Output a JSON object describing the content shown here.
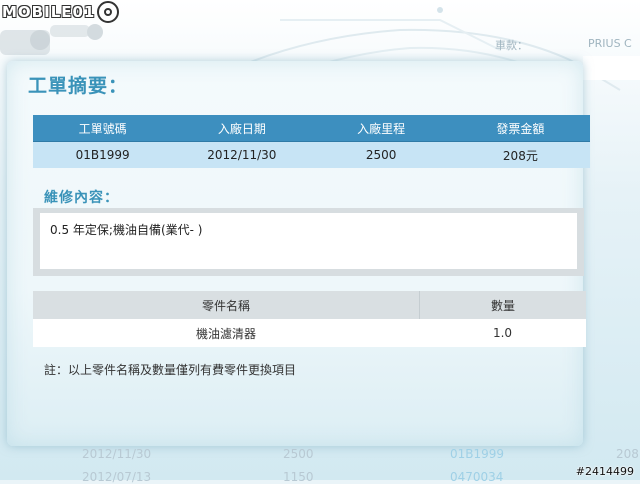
{
  "brand": {
    "logo_text": "MOBILE01"
  },
  "background": {
    "car_model_label": "車款：",
    "car_model_value": "PRIUS C",
    "bottom_rows": [
      [
        "2012/11/30",
        "2500",
        "01B1999",
        "208"
      ],
      [
        "2012/07/13",
        "1150",
        "0470034",
        ""
      ]
    ]
  },
  "card": {
    "title": "工單摘要：",
    "order_table": {
      "headers": [
        "工單號碼",
        "入廠日期",
        "入廠里程",
        "發票金額"
      ],
      "row": [
        "01B1999",
        "2012/11/30",
        "2500",
        "208元"
      ]
    },
    "repair": {
      "title": "維修內容：",
      "content": "0.5 年定保;機油自備(業代-        )"
    },
    "parts_table": {
      "headers": [
        "零件名稱",
        "數量"
      ],
      "rows": [
        [
          "機油濾清器",
          "1.0"
        ]
      ]
    },
    "note": "註：以上零件名稱及數量僅列有費零件更換項目"
  },
  "watermark": "#2414499",
  "colors": {
    "accent": "#3a93b9",
    "header_blue": "#3d8fbf",
    "row_blue": "#c7e4f5"
  }
}
